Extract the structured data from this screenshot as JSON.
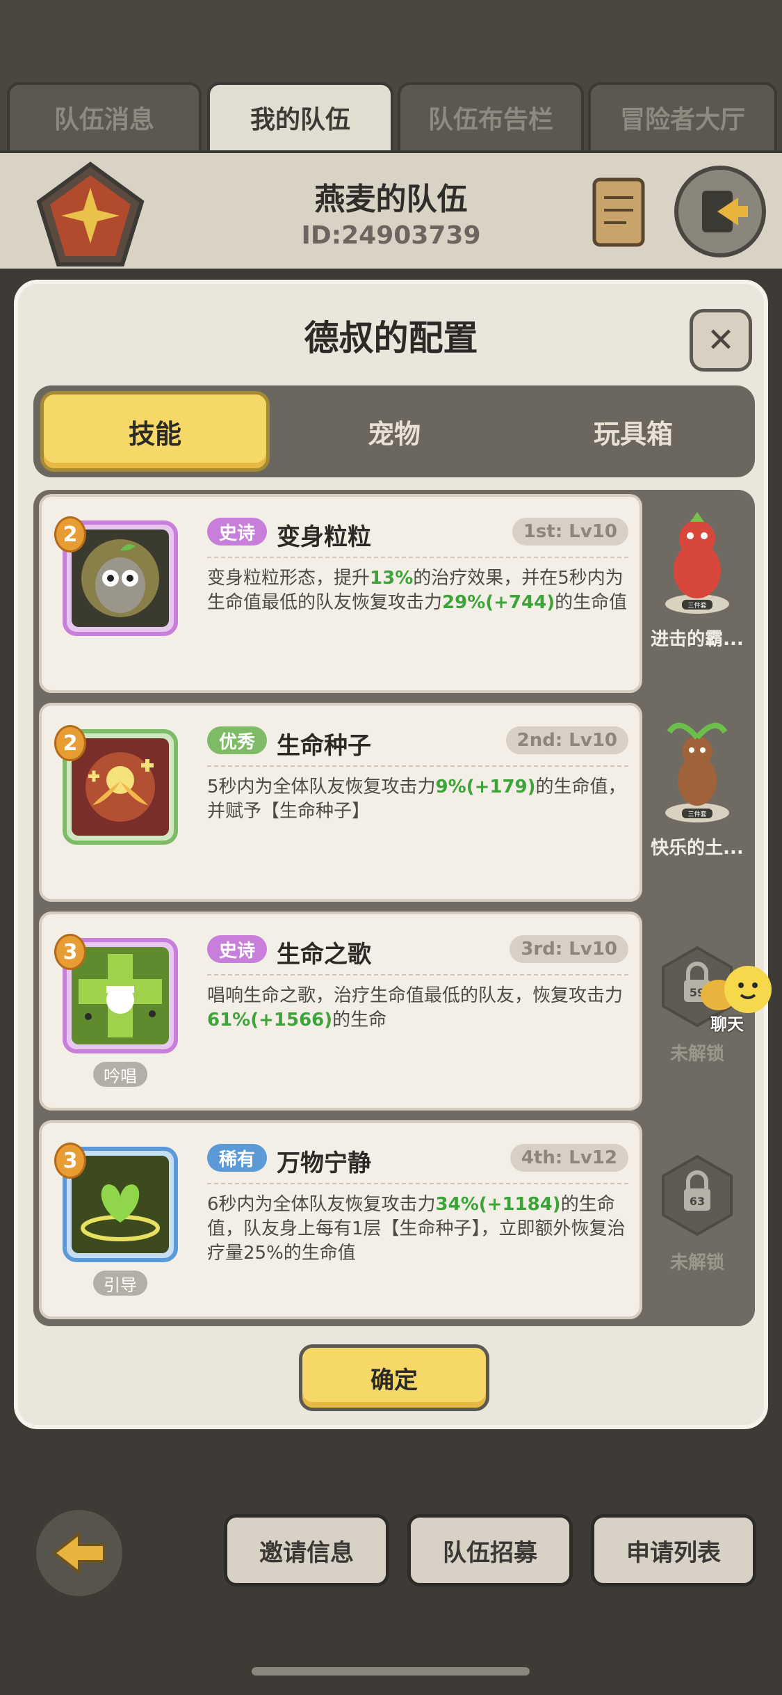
{
  "top_tabs": [
    {
      "label": "队伍消息",
      "active": false
    },
    {
      "label": "我的队伍",
      "active": true
    },
    {
      "label": "队伍布告栏",
      "active": false
    },
    {
      "label": "冒险者大厅",
      "active": false
    }
  ],
  "team": {
    "name": "燕麦的队伍",
    "id": "ID:24903739"
  },
  "modal": {
    "title": "德叔的配置",
    "segments": [
      {
        "label": "技能",
        "active": true
      },
      {
        "label": "宠物",
        "active": false
      },
      {
        "label": "玩具箱",
        "active": false
      }
    ],
    "skills": [
      {
        "badge": "2",
        "rarity": "史诗",
        "rarity_color": "#c77fd9",
        "name": "变身粒粒",
        "level": "1st: Lv10",
        "desc_a": "变身粒粒形态，提升",
        "val1": "13%",
        "desc_b": "的治疗效果，并在5秒内为生命值最低的队友恢复攻击力",
        "val2": "29%(+744)",
        "desc_c": "的生命值",
        "tag": ""
      },
      {
        "badge": "2",
        "rarity": "优秀",
        "rarity_color": "#7dbb66",
        "name": "生命种子",
        "level": "2nd: Lv10",
        "desc_a": "5秒内为全体队友恢复攻击力",
        "val1": "9%(+179)",
        "desc_b": "的生命值，并赋予【生命种子】",
        "val2": "",
        "desc_c": "",
        "tag": ""
      },
      {
        "badge": "3",
        "rarity": "史诗",
        "rarity_color": "#c77fd9",
        "name": "生命之歌",
        "level": "3rd: Lv10",
        "desc_a": "唱响生命之歌，治疗生命值最低的队友，恢复攻击力",
        "val1": "61%(+1566)",
        "desc_b": "的生命",
        "val2": "",
        "desc_c": "",
        "tag": "吟唱"
      },
      {
        "badge": "3",
        "rarity": "稀有",
        "rarity_color": "#5b9ad6",
        "name": "万物宁静",
        "level": "4th: Lv12",
        "desc_a": "6秒内为全体队友恢复攻击力",
        "val1": "34%(+1184)",
        "desc_b": "的生命值，队友身上每有1层【生命种子】，立即额外恢复治疗量25%的生命值",
        "val2": "",
        "desc_c": "",
        "tag": "引导"
      }
    ],
    "side": [
      {
        "label": "进击的霸...",
        "set_tag": "三件套",
        "locked": false
      },
      {
        "label": "快乐的土...",
        "set_tag": "三件套",
        "locked": false
      },
      {
        "label": "未解锁",
        "lock_level": "59",
        "locked": true
      },
      {
        "label": "未解锁",
        "lock_level": "63",
        "locked": true
      }
    ],
    "confirm_label": "确定"
  },
  "chat_label": "聊天",
  "bottom_buttons": [
    "邀请信息",
    "队伍招募",
    "申请列表"
  ]
}
